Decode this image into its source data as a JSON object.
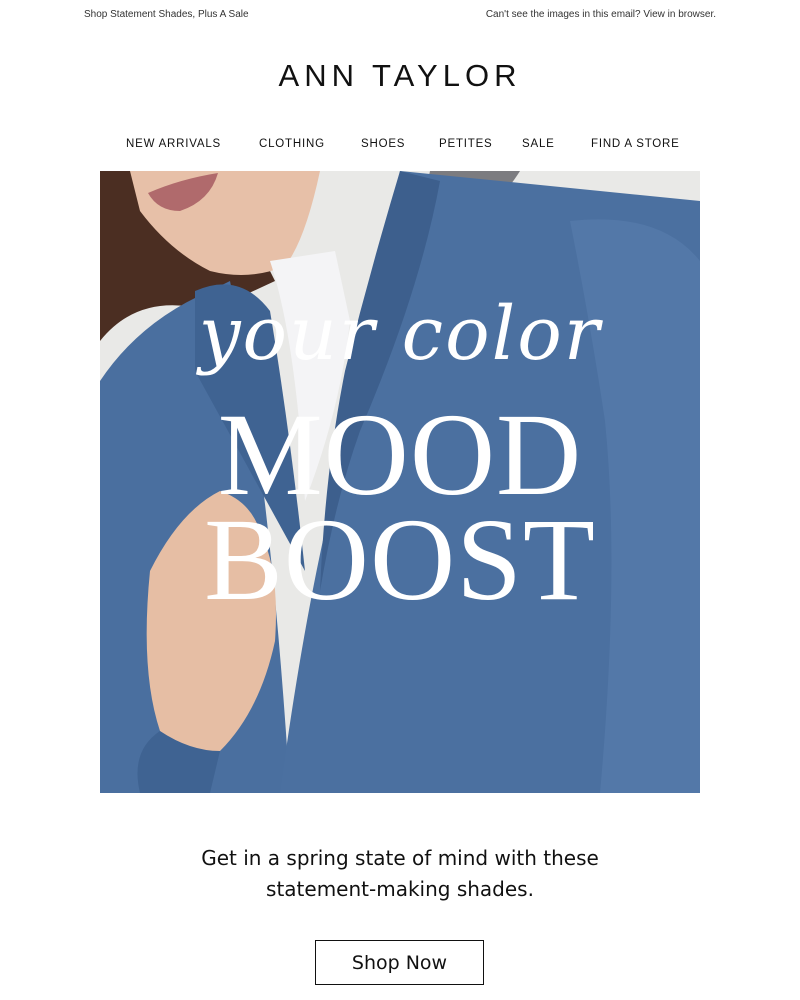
{
  "preheader": {
    "left_text": "Shop Statement Shades, Plus A Sale",
    "right_text": "Can't see the images in this email? View in browser."
  },
  "brand": {
    "logo_text": "ANN TAYLOR"
  },
  "nav": {
    "items": [
      {
        "label": "NEW ARRIVALS"
      },
      {
        "label": "CLOTHING"
      },
      {
        "label": "SHOES"
      },
      {
        "label": "PETITES"
      },
      {
        "label": "SALE"
      },
      {
        "label": "FIND A STORE"
      }
    ]
  },
  "hero": {
    "script_text": "your color",
    "line1": "MOOD",
    "line2": "BOOST",
    "jacket_color": "#4a6f9f",
    "background_color": "#e9e9e7"
  },
  "body": {
    "line1": "Get in a spring state of mind with these",
    "line2": "statement-making shades."
  },
  "cta": {
    "label": "Shop Now"
  }
}
